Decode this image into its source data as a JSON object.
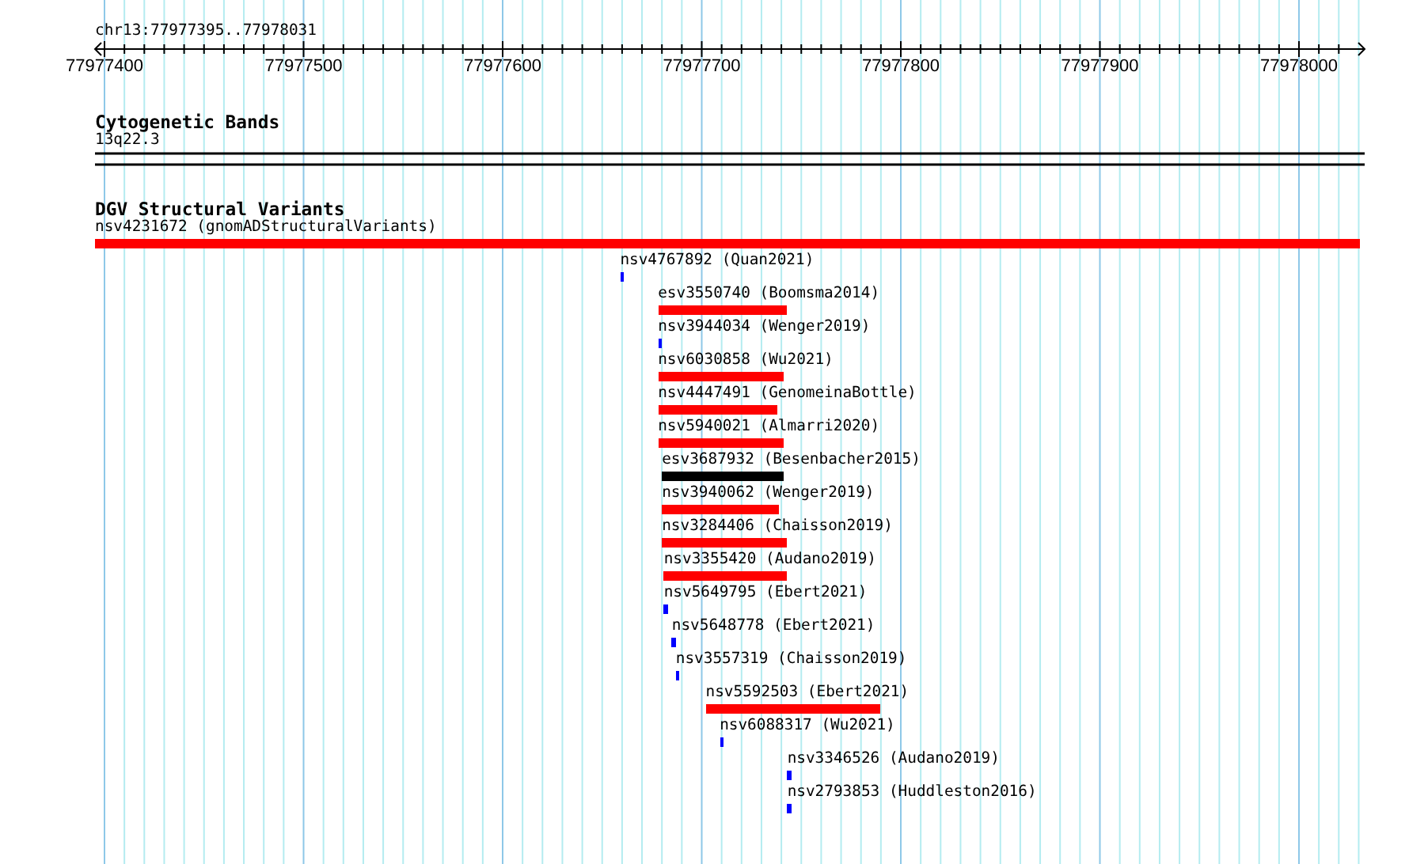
{
  "ruler": {
    "range": "chr13:77977395..77978031",
    "ticks": [
      "77977400",
      "77977500",
      "77977600",
      "77977700",
      "77977800",
      "77977900",
      "77978000"
    ]
  },
  "tracks": [
    {
      "kind": "bands",
      "title": "Cytogenetic Bands",
      "bands": [
        {
          "name": "13q22.3"
        }
      ]
    },
    {
      "kind": "variants",
      "title": "DGV Structural Variants",
      "features": [
        {
          "label": "nsv4231672 (gnomADStructuralVariants)",
          "color": "#ff0000"
        },
        {
          "label": "nsv4767892 (Quan2021)",
          "color": "#0000ff"
        },
        {
          "label": "esv3550740 (Boomsma2014)",
          "color": "#ff0000"
        },
        {
          "label": "nsv3944034 (Wenger2019)",
          "color": "#0000ff"
        },
        {
          "label": "nsv6030858 (Wu2021)",
          "color": "#ff0000"
        },
        {
          "label": "nsv4447491 (GenomeinaBottle)",
          "color": "#ff0000"
        },
        {
          "label": "nsv5940021 (Almarri2020)",
          "color": "#ff0000"
        },
        {
          "label": "esv3687932 (Besenbacher2015)",
          "color": "#000000"
        },
        {
          "label": "nsv3940062 (Wenger2019)",
          "color": "#ff0000"
        },
        {
          "label": "nsv3284406 (Chaisson2019)",
          "color": "#ff0000"
        },
        {
          "label": "nsv3355420 (Audano2019)",
          "color": "#ff0000"
        },
        {
          "label": "nsv5649795 (Ebert2021)",
          "color": "#0000ff"
        },
        {
          "label": "nsv5648778 (Ebert2021)",
          "color": "#0000ff"
        },
        {
          "label": "nsv3557319 (Chaisson2019)",
          "color": "#0000ff"
        },
        {
          "label": "nsv5592503 (Ebert2021)",
          "color": "#ff0000"
        },
        {
          "label": "nsv6088317 (Wu2021)",
          "color": "#0000ff"
        },
        {
          "label": "nsv3346526 (Audano2019)",
          "color": "#0000ff"
        },
        {
          "label": "nsv2793853 (Huddleston2016)",
          "color": "#0000ff"
        }
      ]
    }
  ]
}
